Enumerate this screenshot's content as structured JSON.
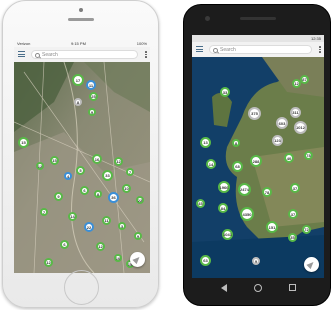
{
  "ios": {
    "status": {
      "carrier": "Verizon",
      "time": "9:15 PM",
      "battery": "100%"
    },
    "search": {
      "placeholder": "Search"
    },
    "clusters": [
      {
        "label": "17"
      },
      {
        "label": "11"
      },
      {
        "label": "25"
      },
      {
        "label": "8"
      },
      {
        "label": "9"
      },
      {
        "label": "15"
      },
      {
        "label": "12"
      },
      {
        "label": "15"
      },
      {
        "label": "4"
      },
      {
        "label": "5"
      },
      {
        "label": "16"
      },
      {
        "label": "33"
      },
      {
        "label": "12"
      },
      {
        "label": "7"
      },
      {
        "label": "6"
      },
      {
        "label": "8"
      },
      {
        "label": "36"
      },
      {
        "label": "10"
      },
      {
        "label": "22"
      },
      {
        "label": "9"
      },
      {
        "label": "7"
      },
      {
        "label": "14"
      },
      {
        "label": "22"
      },
      {
        "label": "11"
      },
      {
        "label": "3"
      },
      {
        "label": "9"
      },
      {
        "label": "6"
      },
      {
        "label": "12"
      },
      {
        "label": "10"
      },
      {
        "label": "12"
      },
      {
        "label": "15"
      }
    ]
  },
  "android": {
    "status": {
      "time": "12:35"
    },
    "search": {
      "placeholder": "Search"
    },
    "clusters": [
      {
        "label": "13"
      },
      {
        "label": "33"
      },
      {
        "label": "8"
      },
      {
        "label": "311"
      },
      {
        "label": "12"
      },
      {
        "label": "87"
      },
      {
        "label": "375"
      },
      {
        "label": "603"
      },
      {
        "label": "1012"
      },
      {
        "label": "123"
      },
      {
        "label": "14"
      },
      {
        "label": "68"
      },
      {
        "label": "288"
      },
      {
        "label": "40"
      },
      {
        "label": "78"
      },
      {
        "label": "1966"
      },
      {
        "label": "2474"
      },
      {
        "label": "78"
      },
      {
        "label": "37"
      },
      {
        "label": "45"
      },
      {
        "label": "84"
      },
      {
        "label": "4350"
      },
      {
        "label": "37"
      },
      {
        "label": "151"
      },
      {
        "label": "1041"
      },
      {
        "label": "35"
      },
      {
        "label": "72"
      },
      {
        "label": "63"
      },
      {
        "label": "9"
      }
    ]
  }
}
